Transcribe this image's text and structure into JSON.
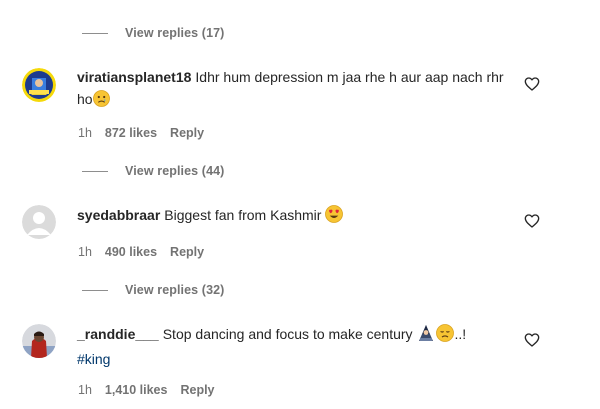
{
  "threads": [
    {
      "view_replies": "View replies (17)"
    }
  ],
  "comments": [
    {
      "username": "viratiansplanet18",
      "text": "Idhr hum depression m jaa rhe h aur aap nach rhr ho",
      "emoji": "sad-face",
      "time": "1h",
      "likes": "872 likes",
      "reply": "Reply",
      "view_replies": "View replies (44)"
    },
    {
      "username": "syedabbraar",
      "text": "Biggest fan from Kashmir",
      "emoji": "heart-eyes-face",
      "time": "1h",
      "likes": "490 likes",
      "reply": "Reply",
      "view_replies": "View replies (32)"
    },
    {
      "username": "_randdie___",
      "text": "Stop dancing and focus to make century",
      "emoji_suffix": "..!",
      "hashtag": "#king",
      "time": "1h",
      "likes": "1,410 likes",
      "reply": "Reply"
    }
  ],
  "colors": {
    "text": "#262626",
    "secondary": "#737373",
    "hashtag": "#00376b",
    "background": "#ffffff"
  },
  "icons": {
    "like": "heart-outline-icon",
    "sad": "sad-face-emoji",
    "love": "heart-eyes-emoji",
    "person": "hooded-person-emoji",
    "disappointed": "disappointed-face-emoji"
  }
}
